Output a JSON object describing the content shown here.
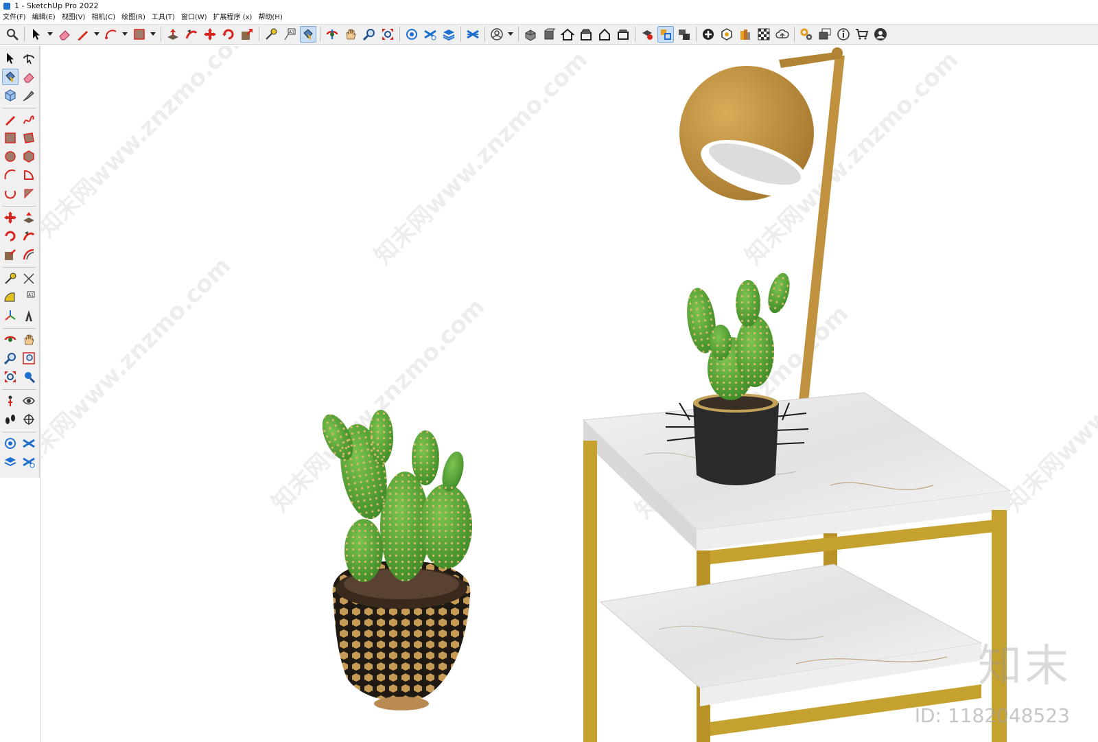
{
  "window": {
    "title": "1 - SketchUp Pro 2022"
  },
  "menu": [
    "文件(F)",
    "编辑(E)",
    "视图(V)",
    "相机(C)",
    "绘图(R)",
    "工具(T)",
    "窗口(W)",
    "扩展程序 (x)",
    "帮助(H)"
  ],
  "watermark": {
    "text": "知末网www.znzmo.com",
    "brand": "知末",
    "id": "ID: 1182048523"
  },
  "icons": {
    "top": [
      "search-icon",
      "select-icon",
      "eraser-icon",
      "pencil-icon",
      "arc-icon",
      "rectangle-icon",
      "push-pull-icon",
      "follow-me-icon",
      "move-icon",
      "rotate-icon",
      "scale-icon",
      "tape-measure-icon",
      "text-icon",
      "paint-bucket-icon",
      "orbit-icon",
      "pan-icon",
      "zoom-icon",
      "zoom-extents-icon",
      "warehouse-icon",
      "extension-icon",
      "layers-icon",
      "sandbox-icon",
      "profile-icon",
      "iso-view-icon",
      "front-view-icon",
      "home-view-icon",
      "top-view-icon",
      "right-view-icon",
      "back-view-icon",
      "styles-icon",
      "shadows-icon",
      "sections-icon",
      "add-icon",
      "solid-icon",
      "materials-icon",
      "xray-icon",
      "cloud-icon",
      "settings-icon",
      "scenes-icon",
      "info-icon",
      "cart-icon",
      "account-icon"
    ],
    "left": [
      "select-icon",
      "orbit-icon",
      "paint-bucket-icon",
      "eraser-icon",
      "component-icon",
      "tag-icon",
      "pencil-icon",
      "freehand-icon",
      "rectangle-icon",
      "rotated-rectangle-icon",
      "circle-icon",
      "polygon-icon",
      "arc-icon",
      "pie-icon",
      "two-point-arc-icon",
      "three-point-arc-icon",
      "move-icon",
      "push-pull-icon",
      "rotate-icon",
      "follow-me-icon",
      "scale-icon",
      "offset-icon",
      "tape-measure-icon",
      "dimension-icon",
      "protractor-icon",
      "text-icon",
      "axes-icon",
      "3d-text-icon",
      "orbit-icon",
      "pan-icon",
      "zoom-icon",
      "zoom-window-icon",
      "zoom-extents-icon",
      "previous-view-icon",
      "position-camera-icon",
      "look-around-icon",
      "walk-icon",
      "section-plane-icon",
      "warehouse-icon",
      "extension-icon",
      "layers-icon",
      "sandbox-icon"
    ]
  },
  "colors": {
    "accent_red": "#d8261f",
    "accent_blue": "#1e6fd0",
    "toolbar_bg": "#f0f0f0",
    "lamp": "#c0913f",
    "frame_gold": "#c5a12f",
    "cactus": "#58a83a"
  }
}
